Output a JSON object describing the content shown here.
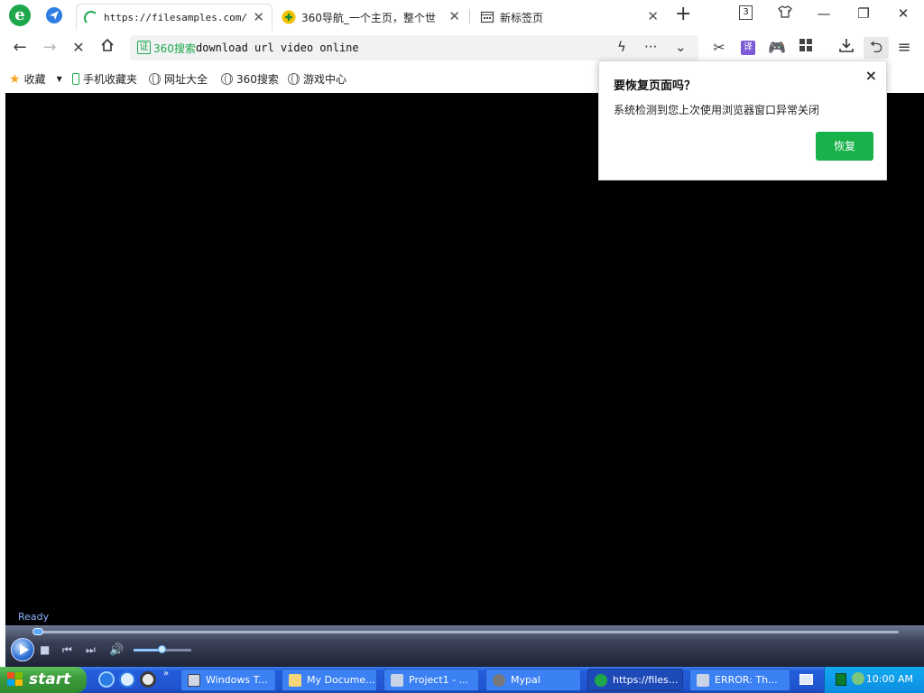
{
  "browser": {
    "tabs": [
      {
        "label": "https://filesamples.com/sa",
        "active": true,
        "icon": "loading-spinner-icon"
      },
      {
        "label": "360导航_一个主页，整个世",
        "active": false,
        "icon": "360-nav-icon"
      },
      {
        "label": "新标签页",
        "active": false,
        "icon": "new-tab-page-icon"
      }
    ],
    "tab_count": "3",
    "address_bar": {
      "search_engine": "360搜索",
      "cert_label": "证",
      "url": "download url video online"
    },
    "bookmarks": [
      {
        "label": "收藏",
        "icon": "star-icon"
      },
      {
        "label": "手机收藏夹",
        "icon": "phone-icon"
      },
      {
        "label": "网址大全",
        "icon": "globe-icon"
      },
      {
        "label": "360搜索",
        "icon": "globe-icon"
      },
      {
        "label": "游戏中心",
        "icon": "globe-icon"
      }
    ]
  },
  "restore_popup": {
    "title": "要恢复页面吗？",
    "message": "系统检测到您上次使用浏览器窗口异常关闭",
    "restore_label": "恢复",
    "close_label": "×"
  },
  "player": {
    "status": "Ready",
    "seek_fraction": 0.0,
    "volume_fraction": 0.5
  },
  "taskbar": {
    "start_label": "start",
    "tasks": [
      {
        "label": "Windows T...",
        "active": false
      },
      {
        "label": "My Docume...",
        "active": false
      },
      {
        "label": "Project1 - ...",
        "active": false
      },
      {
        "label": "Mypal",
        "active": false
      },
      {
        "label": "https://files...",
        "active": true
      },
      {
        "label": "ERROR: Th...",
        "active": false
      }
    ],
    "clock": "10:00 AM"
  },
  "colors": {
    "brand_green": "#1ea84b",
    "restore_button": "#17b24a",
    "taskbar_blue": "#245edb",
    "start_green": "#3c9b3c"
  }
}
